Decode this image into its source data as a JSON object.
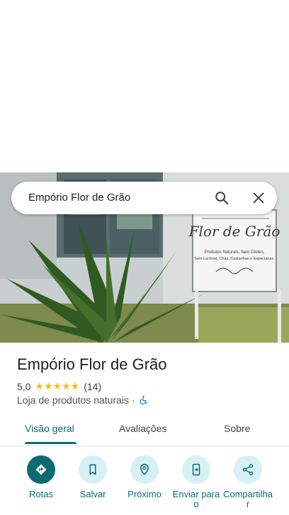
{
  "search": {
    "query": "Empório Flor de Grão"
  },
  "hero_sign": {
    "title": "Flor de Grão",
    "line1": "Produtos Naturais, Sem Glúten,",
    "line2": "Sem Lactose, Chás, Castanhas e Especiarias."
  },
  "place": {
    "name": "Empório Flor de Grão",
    "rating": "5,0",
    "stars": "★★★★★",
    "review_count": "(14)",
    "category": "Loja de produtos naturais",
    "separator": "·"
  },
  "tabs": [
    {
      "label": "Visão geral",
      "active": true
    },
    {
      "label": "Avaliações",
      "active": false
    },
    {
      "label": "Sobre",
      "active": false
    }
  ],
  "actions": [
    {
      "label": "Rotas",
      "icon": "directions-icon"
    },
    {
      "label": "Salvar",
      "icon": "bookmark-icon"
    },
    {
      "label": "Próximo",
      "icon": "nearby-icon"
    },
    {
      "label": "Enviar para o",
      "icon": "send-to-phone-icon"
    },
    {
      "label": "Compartilhar",
      "icon": "share-icon"
    }
  ],
  "colors": {
    "accent": "#0b6b73",
    "accent_light": "#d6f1f5",
    "star": "#fbbc04"
  }
}
